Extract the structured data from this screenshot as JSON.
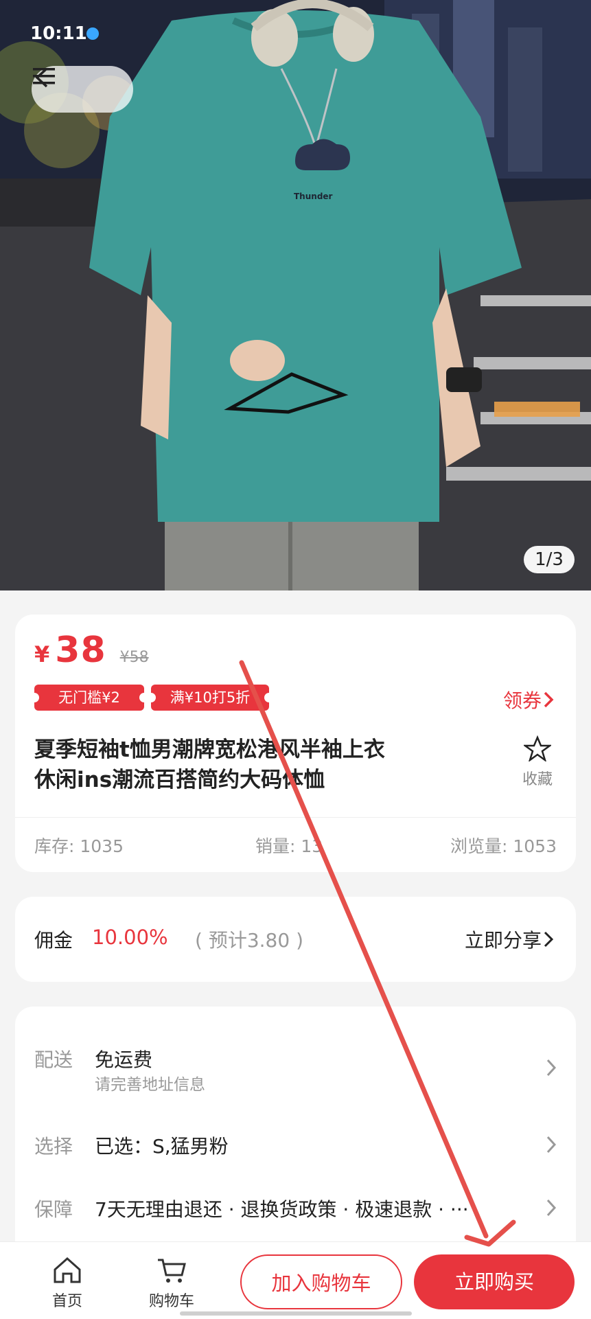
{
  "status_bar": {
    "time": "10:11"
  },
  "hero": {
    "page_indicator": "1/3",
    "shirt_print": "Thunder"
  },
  "product": {
    "currency": "¥",
    "price": "38",
    "original_price": "¥58",
    "coupons": [
      "无门槛¥2",
      "满¥10打5折"
    ],
    "get_coupon_label": "领券",
    "title_line1": "夏季短袖t恤男潮牌宽松港风半袖上衣",
    "title_line2": "休闲ins潮流百搭简约大码体恤",
    "favorite_label": "收藏",
    "stats": {
      "stock": "库存: 1035",
      "sales": "销量: 13",
      "views": "浏览量: 1053"
    }
  },
  "commission": {
    "label": "佣金",
    "rate": "10.00%",
    "estimate": "( 预计3.80 )",
    "share_label": "立即分享"
  },
  "info_rows": {
    "shipping": {
      "label": "配送",
      "value": "免运费",
      "sub": "请完善地址信息"
    },
    "select": {
      "label": "选择",
      "value": "已选：S,猛男粉"
    },
    "guarantee": {
      "label": "保障",
      "value": "7天无理由退还 · 退换货政策 · 极速退款 · ···"
    }
  },
  "bottom_bar": {
    "home_label": "首页",
    "cart_label": "购物车",
    "add_to_cart": "加入购物车",
    "buy_now": "立即购买"
  },
  "colors": {
    "accent": "#e8353d",
    "shirt": "#3f9c97",
    "annotation_arrow": "#e5504b"
  }
}
